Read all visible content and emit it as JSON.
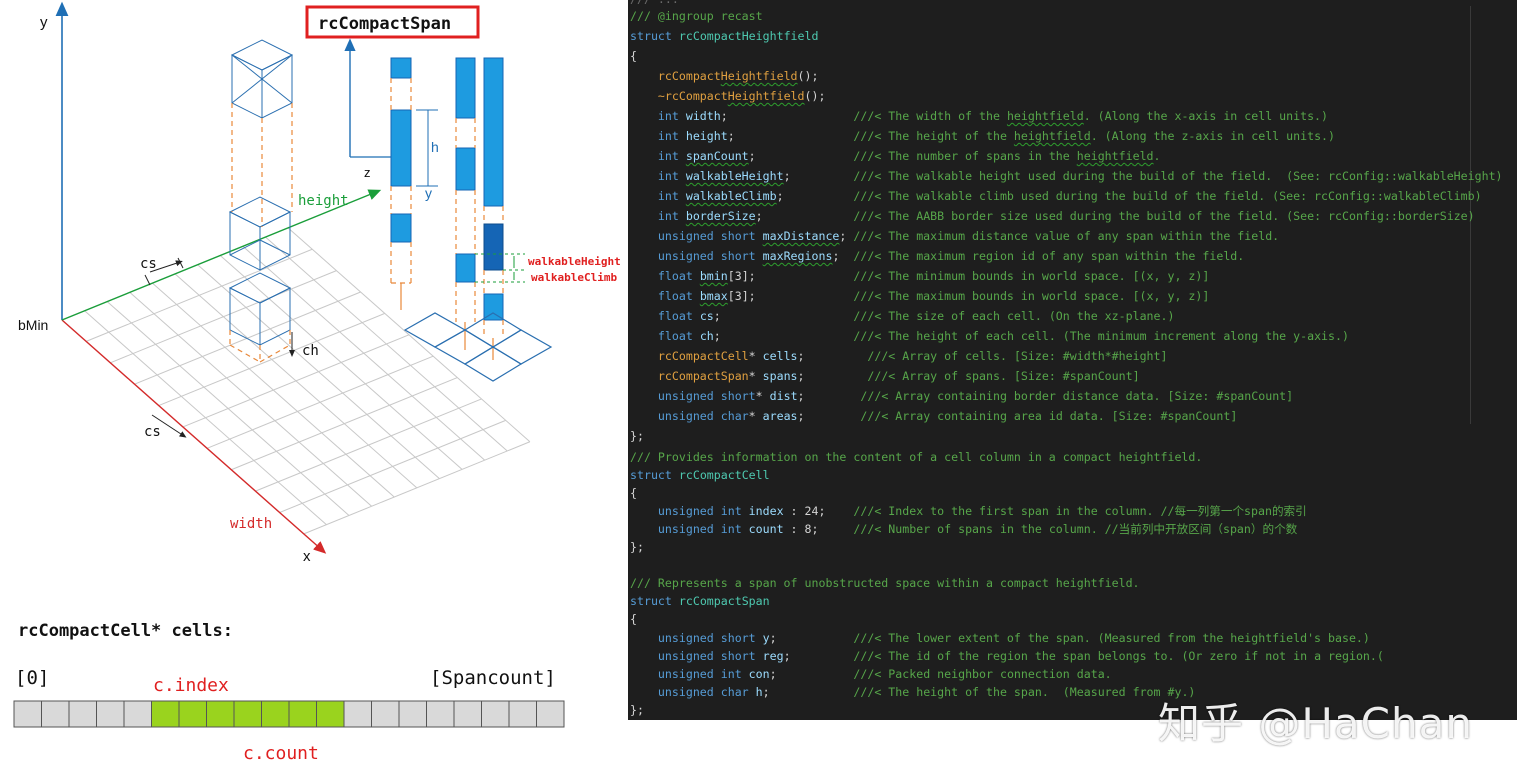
{
  "diagram": {
    "title_label": "rcCompactSpan",
    "axis_y": "y",
    "axis_x": "x",
    "axis_z": "z",
    "axis_y_small": "y",
    "label_height": "height",
    "label_width": "width",
    "label_bmin": "bMin",
    "label_cs_top": "cs",
    "label_cs_bottom": "cs",
    "label_ch": "ch",
    "label_h": "h",
    "label_walkable_height": "walkableHeight",
    "label_walkable_climb": "walkableClimb",
    "cells_title": "rcCompactCell* cells:",
    "index_start": "[0]",
    "index_end": "[Spancount]",
    "label_c_index": "c.index",
    "label_c_count": "c.count",
    "array_total_cells": 20,
    "array_highlight_start": 5,
    "array_highlight_count": 7,
    "colors": {
      "axis_blue": "#1f6fb5",
      "axis_red": "#d42a2a",
      "axis_green": "#1a9e3a",
      "span_blue": "#1e9be0",
      "span_dark": "#1565b5",
      "dashed_orange": "#e8883a",
      "highlight_green": "#9ad31e",
      "cell_gray": "#d9d9d9",
      "title_red": "#e02020",
      "label_red": "#e02020"
    }
  },
  "code": {
    "top_cut": "/// ...",
    "lines": [
      {
        "parts": [
          [
            "c",
            "/// @ingroup recast"
          ]
        ]
      },
      {
        "parts": [
          [
            "k",
            "struct "
          ],
          [
            "t",
            "rcCompactHeightfield"
          ]
        ]
      },
      {
        "parts": [
          [
            "p",
            "{"
          ]
        ]
      },
      {
        "parts": [
          [
            "p",
            "    "
          ],
          [
            "f",
            "rcCompact"
          ],
          [
            "fsq",
            "Heightfield"
          ],
          [
            "p",
            "();"
          ]
        ]
      },
      {
        "parts": [
          [
            "p",
            "    "
          ],
          [
            "f",
            "~rcCompact"
          ],
          [
            "fsq",
            "Heightfield"
          ],
          [
            "p",
            "();"
          ]
        ]
      },
      {
        "parts": [
          [
            "p",
            "    "
          ],
          [
            "k",
            "int "
          ],
          [
            "m",
            "width"
          ],
          [
            "p",
            ";                  "
          ],
          [
            "c",
            "///< The width of the "
          ],
          [
            "csq",
            "heightfield"
          ],
          [
            "c",
            ". (Along the x-axis in cell units.)"
          ]
        ]
      },
      {
        "parts": [
          [
            "p",
            "    "
          ],
          [
            "k",
            "int "
          ],
          [
            "m",
            "height"
          ],
          [
            "p",
            ";                 "
          ],
          [
            "c",
            "///< The height of the "
          ],
          [
            "csq",
            "heightfield"
          ],
          [
            "c",
            ". (Along the z-axis in cell units.)"
          ]
        ]
      },
      {
        "parts": [
          [
            "p",
            "    "
          ],
          [
            "k",
            "int "
          ],
          [
            "msq",
            "spanCount"
          ],
          [
            "p",
            ";              "
          ],
          [
            "c",
            "///< The number of spans in the "
          ],
          [
            "csq",
            "heightfield"
          ],
          [
            "c",
            "."
          ]
        ]
      },
      {
        "parts": [
          [
            "p",
            "    "
          ],
          [
            "k",
            "int "
          ],
          [
            "msq",
            "walkableHeight"
          ],
          [
            "p",
            ";         "
          ],
          [
            "c",
            "///< The walkable height used during the build of the field.  (See: rcConfig::walkableHeight)"
          ]
        ]
      },
      {
        "parts": [
          [
            "p",
            "    "
          ],
          [
            "k",
            "int "
          ],
          [
            "msq",
            "walkableClimb"
          ],
          [
            "p",
            ";          "
          ],
          [
            "c",
            "///< The walkable climb used during the build of the field. (See: rcConfig::walkableClimb)"
          ]
        ]
      },
      {
        "parts": [
          [
            "p",
            "    "
          ],
          [
            "k",
            "int "
          ],
          [
            "msq",
            "borderSize"
          ],
          [
            "p",
            ";             "
          ],
          [
            "c",
            "///< The AABB border size used during the build of the field. (See: rcConfig::borderSize)"
          ]
        ]
      },
      {
        "parts": [
          [
            "p",
            "    "
          ],
          [
            "k",
            "unsigned short "
          ],
          [
            "msq",
            "maxDistance"
          ],
          [
            "p",
            "; "
          ],
          [
            "c",
            "///< The maximum distance value of any span within the field."
          ]
        ]
      },
      {
        "parts": [
          [
            "p",
            "    "
          ],
          [
            "k",
            "unsigned short "
          ],
          [
            "msq",
            "maxRegions"
          ],
          [
            "p",
            ";  "
          ],
          [
            "c",
            "///< The maximum region id of any span within the field."
          ]
        ]
      },
      {
        "parts": [
          [
            "p",
            "    "
          ],
          [
            "k",
            "float "
          ],
          [
            "msq",
            "bmin"
          ],
          [
            "p",
            "[3];              "
          ],
          [
            "c",
            "///< The minimum bounds in world space. [(x, y, z)]"
          ]
        ]
      },
      {
        "parts": [
          [
            "p",
            "    "
          ],
          [
            "k",
            "float "
          ],
          [
            "msq",
            "bmax"
          ],
          [
            "p",
            "[3];              "
          ],
          [
            "c",
            "///< The maximum bounds in world space. [(x, y, z)]"
          ]
        ]
      },
      {
        "parts": [
          [
            "p",
            "    "
          ],
          [
            "k",
            "float "
          ],
          [
            "m",
            "cs"
          ],
          [
            "p",
            ";                   "
          ],
          [
            "c",
            "///< The size of each cell. (On the xz-plane.)"
          ]
        ]
      },
      {
        "parts": [
          [
            "p",
            "    "
          ],
          [
            "k",
            "float "
          ],
          [
            "m",
            "ch"
          ],
          [
            "p",
            ";                   "
          ],
          [
            "c",
            "///< The height of each cell. (The minimum increment along the y-axis.)"
          ]
        ]
      },
      {
        "parts": [
          [
            "p",
            "    "
          ],
          [
            "f",
            "rcCompactCell"
          ],
          [
            "p",
            "* "
          ],
          [
            "m",
            "cells"
          ],
          [
            "p",
            ";         "
          ],
          [
            "c",
            "///< Array of cells. [Size: #width*#height]"
          ]
        ]
      },
      {
        "parts": [
          [
            "p",
            "    "
          ],
          [
            "f",
            "rcCompactSpan"
          ],
          [
            "p",
            "* "
          ],
          [
            "m",
            "spans"
          ],
          [
            "p",
            ";         "
          ],
          [
            "c",
            "///< Array of spans. [Size: #spanCount]"
          ]
        ]
      },
      {
        "parts": [
          [
            "p",
            "    "
          ],
          [
            "k",
            "unsigned short"
          ],
          [
            "p",
            "* "
          ],
          [
            "m",
            "dist"
          ],
          [
            "p",
            ";        "
          ],
          [
            "c",
            "///< Array containing border distance data. [Size: #spanCount]"
          ]
        ]
      },
      {
        "parts": [
          [
            "p",
            "    "
          ],
          [
            "k",
            "unsigned char"
          ],
          [
            "p",
            "* "
          ],
          [
            "m",
            "areas"
          ],
          [
            "p",
            ";        "
          ],
          [
            "c",
            "///< Array containing area id data. [Size: #spanCount]"
          ]
        ]
      },
      {
        "parts": [
          [
            "p",
            "};"
          ]
        ]
      }
    ],
    "lines2": [
      {
        "parts": [
          [
            "c",
            "/// Provides information on the content of a cell column in a compact heightfield."
          ]
        ]
      },
      {
        "parts": [
          [
            "k",
            "struct "
          ],
          [
            "t",
            "rcCompactCell"
          ]
        ]
      },
      {
        "parts": [
          [
            "p",
            "{"
          ]
        ]
      },
      {
        "parts": [
          [
            "p",
            "    "
          ],
          [
            "k",
            "unsigned int "
          ],
          [
            "m",
            "index"
          ],
          [
            "p",
            " : 24;    "
          ],
          [
            "c",
            "///< Index to the first span in the column. //每一列第一个span的索引"
          ]
        ]
      },
      {
        "parts": [
          [
            "p",
            "    "
          ],
          [
            "k",
            "unsigned int "
          ],
          [
            "m",
            "count"
          ],
          [
            "p",
            " : 8;     "
          ],
          [
            "c",
            "///< Number of spans in the column. //当前列中开放区间（span）的个数"
          ]
        ]
      },
      {
        "parts": [
          [
            "p",
            "};"
          ]
        ]
      },
      {
        "parts": [
          [
            "p",
            ""
          ]
        ]
      },
      {
        "parts": [
          [
            "c",
            "/// Represents a span of unobstructed space within a compact heightfield."
          ]
        ]
      },
      {
        "parts": [
          [
            "k",
            "struct "
          ],
          [
            "t",
            "rcCompactSpan"
          ]
        ]
      },
      {
        "parts": [
          [
            "p",
            "{"
          ]
        ]
      },
      {
        "parts": [
          [
            "p",
            "    "
          ],
          [
            "k",
            "unsigned short "
          ],
          [
            "m",
            "y"
          ],
          [
            "p",
            ";           "
          ],
          [
            "c",
            "///< The lower extent of the span. (Measured from the heightfield's base.)"
          ]
        ]
      },
      {
        "parts": [
          [
            "p",
            "    "
          ],
          [
            "k",
            "unsigned short "
          ],
          [
            "m",
            "reg"
          ],
          [
            "p",
            ";         "
          ],
          [
            "c",
            "///< The id of the region the span belongs to. (Or zero if not in a region.("
          ]
        ]
      },
      {
        "parts": [
          [
            "p",
            "    "
          ],
          [
            "k",
            "unsigned int "
          ],
          [
            "m",
            "con"
          ],
          [
            "p",
            ";           "
          ],
          [
            "c",
            "///< Packed neighbor connection data."
          ]
        ]
      },
      {
        "parts": [
          [
            "p",
            "    "
          ],
          [
            "k",
            "unsigned char "
          ],
          [
            "m",
            "h"
          ],
          [
            "p",
            ";            "
          ],
          [
            "c",
            "///< The height of the span.  (Measured from #y.)"
          ]
        ]
      },
      {
        "parts": [
          [
            "p",
            "};"
          ]
        ]
      }
    ]
  },
  "watermark": "知乎 @HaChan"
}
